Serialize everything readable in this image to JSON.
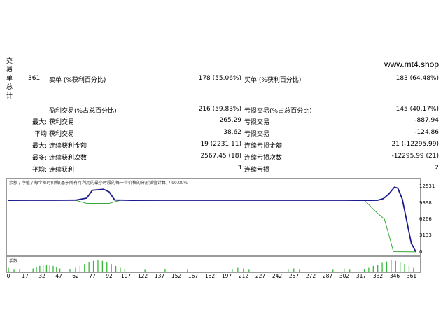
{
  "side_label": [
    "交",
    "易",
    "单",
    "总",
    "计"
  ],
  "site": "www.mt4.shop",
  "summary": {
    "total": "361",
    "sell_label": "卖单 (%获利百分比)",
    "sell_value": "178 (55.06%)",
    "buy_label": "买单 (%获利百分比)",
    "buy_value": "183 (64.48%)"
  },
  "rows": [
    {
      "prefix": "",
      "label": "盈利交易(%占总百分比)",
      "value": "216 (59.83%)",
      "label2": "亏损交易(%占总百分比)",
      "value2": "145 (40.17%)"
    },
    {
      "prefix": "最大:",
      "label": "获利交易",
      "value": "265.29",
      "label2": "亏损交易",
      "value2": "-887.94"
    },
    {
      "prefix": "平均",
      "label": "获利交易",
      "value": "38.62",
      "label2": "亏损交易",
      "value2": "-124.86"
    },
    {
      "prefix": "最大:",
      "label": "连续获利金额",
      "value": "19 (2231.11)",
      "label2": "连续亏损金额",
      "value2": "21 (-12295.99)"
    },
    {
      "prefix": "最多:",
      "label": "连续获利次数",
      "value": "2567.45 (18)",
      "label2": "连续亏损次数",
      "value2": "-12295.99 (21)"
    },
    {
      "prefix": "平均:",
      "label": "连续获利",
      "value": "3",
      "label2": "连续亏损",
      "value2": "2"
    }
  ],
  "chart_data": {
    "type": "line",
    "legend": "余额 / 净值 / 每个柜时价格(基于所有可利用的最小时段的每一个价格的分形插值计算) / 90.00%",
    "series": [
      {
        "name": "余额",
        "color": "#1a1a8c",
        "x": [
          0,
          20,
          40,
          60,
          70,
          75,
          85,
          90,
          95,
          110,
          140,
          180,
          220,
          260,
          300,
          318,
          325,
          330,
          335,
          340,
          345,
          348,
          352,
          356,
          360,
          364
        ],
        "y": [
          9990,
          9995,
          10000,
          10020,
          10400,
          11900,
          12100,
          11600,
          10050,
          9990,
          10000,
          9995,
          10005,
          10000,
          9995,
          9990,
          9992,
          10000,
          10300,
          11200,
          12500,
          12300,
          10200,
          6000,
          1800,
          200
        ]
      },
      {
        "name": "净值",
        "color": "#38a838",
        "x": [
          0,
          60,
          70,
          90,
          100,
          200,
          300,
          318,
          322,
          326,
          330,
          336,
          340,
          344,
          364
        ],
        "y": [
          9990,
          9990,
          9400,
          9400,
          9990,
          9990,
          9990,
          9990,
          9200,
          8300,
          7500,
          6400,
          3400,
          200,
          150
        ]
      }
    ],
    "y_ticks": [
      "12531",
      "9398",
      "6266",
      "3133",
      "0"
    ],
    "ylim": [
      0,
      12531
    ],
    "xlim": [
      0,
      364
    ],
    "volume_label": "手数",
    "volume": [
      {
        "x": 0,
        "h": 0.3
      },
      {
        "x": 5,
        "h": 0.15
      },
      {
        "x": 10,
        "h": 0.2
      },
      {
        "x": 22,
        "h": 0.25
      },
      {
        "x": 25,
        "h": 0.35
      },
      {
        "x": 28,
        "h": 0.45
      },
      {
        "x": 31,
        "h": 0.5
      },
      {
        "x": 34,
        "h": 0.55
      },
      {
        "x": 37,
        "h": 0.5
      },
      {
        "x": 40,
        "h": 0.45
      },
      {
        "x": 43,
        "h": 0.35
      },
      {
        "x": 46,
        "h": 0.25
      },
      {
        "x": 55,
        "h": 0.2
      },
      {
        "x": 60,
        "h": 0.3
      },
      {
        "x": 64,
        "h": 0.45
      },
      {
        "x": 68,
        "h": 0.6
      },
      {
        "x": 72,
        "h": 0.75
      },
      {
        "x": 76,
        "h": 0.85
      },
      {
        "x": 80,
        "h": 0.9
      },
      {
        "x": 84,
        "h": 0.85
      },
      {
        "x": 88,
        "h": 0.75
      },
      {
        "x": 92,
        "h": 0.6
      },
      {
        "x": 96,
        "h": 0.45
      },
      {
        "x": 100,
        "h": 0.3
      },
      {
        "x": 104,
        "h": 0.2
      },
      {
        "x": 122,
        "h": 0.15
      },
      {
        "x": 140,
        "h": 0.2
      },
      {
        "x": 160,
        "h": 0.15
      },
      {
        "x": 200,
        "h": 0.2
      },
      {
        "x": 205,
        "h": 0.3
      },
      {
        "x": 210,
        "h": 0.25
      },
      {
        "x": 215,
        "h": 0.15
      },
      {
        "x": 250,
        "h": 0.2
      },
      {
        "x": 255,
        "h": 0.25
      },
      {
        "x": 260,
        "h": 0.15
      },
      {
        "x": 290,
        "h": 0.15
      },
      {
        "x": 300,
        "h": 0.25
      },
      {
        "x": 305,
        "h": 0.15
      },
      {
        "x": 318,
        "h": 0.2
      },
      {
        "x": 322,
        "h": 0.3
      },
      {
        "x": 326,
        "h": 0.45
      },
      {
        "x": 330,
        "h": 0.55
      },
      {
        "x": 334,
        "h": 0.7
      },
      {
        "x": 338,
        "h": 0.8
      },
      {
        "x": 342,
        "h": 0.9
      },
      {
        "x": 346,
        "h": 0.85
      },
      {
        "x": 350,
        "h": 0.75
      },
      {
        "x": 354,
        "h": 0.6
      },
      {
        "x": 358,
        "h": 0.45
      },
      {
        "x": 362,
        "h": 0.3
      }
    ],
    "x_ticks": [
      "0",
      "17",
      "32",
      "47",
      "62",
      "77",
      "92",
      "107",
      "122",
      "137",
      "152",
      "167",
      "182",
      "197",
      "212",
      "227",
      "242",
      "257",
      "272",
      "287",
      "302",
      "317",
      "332",
      "346",
      "361"
    ]
  }
}
